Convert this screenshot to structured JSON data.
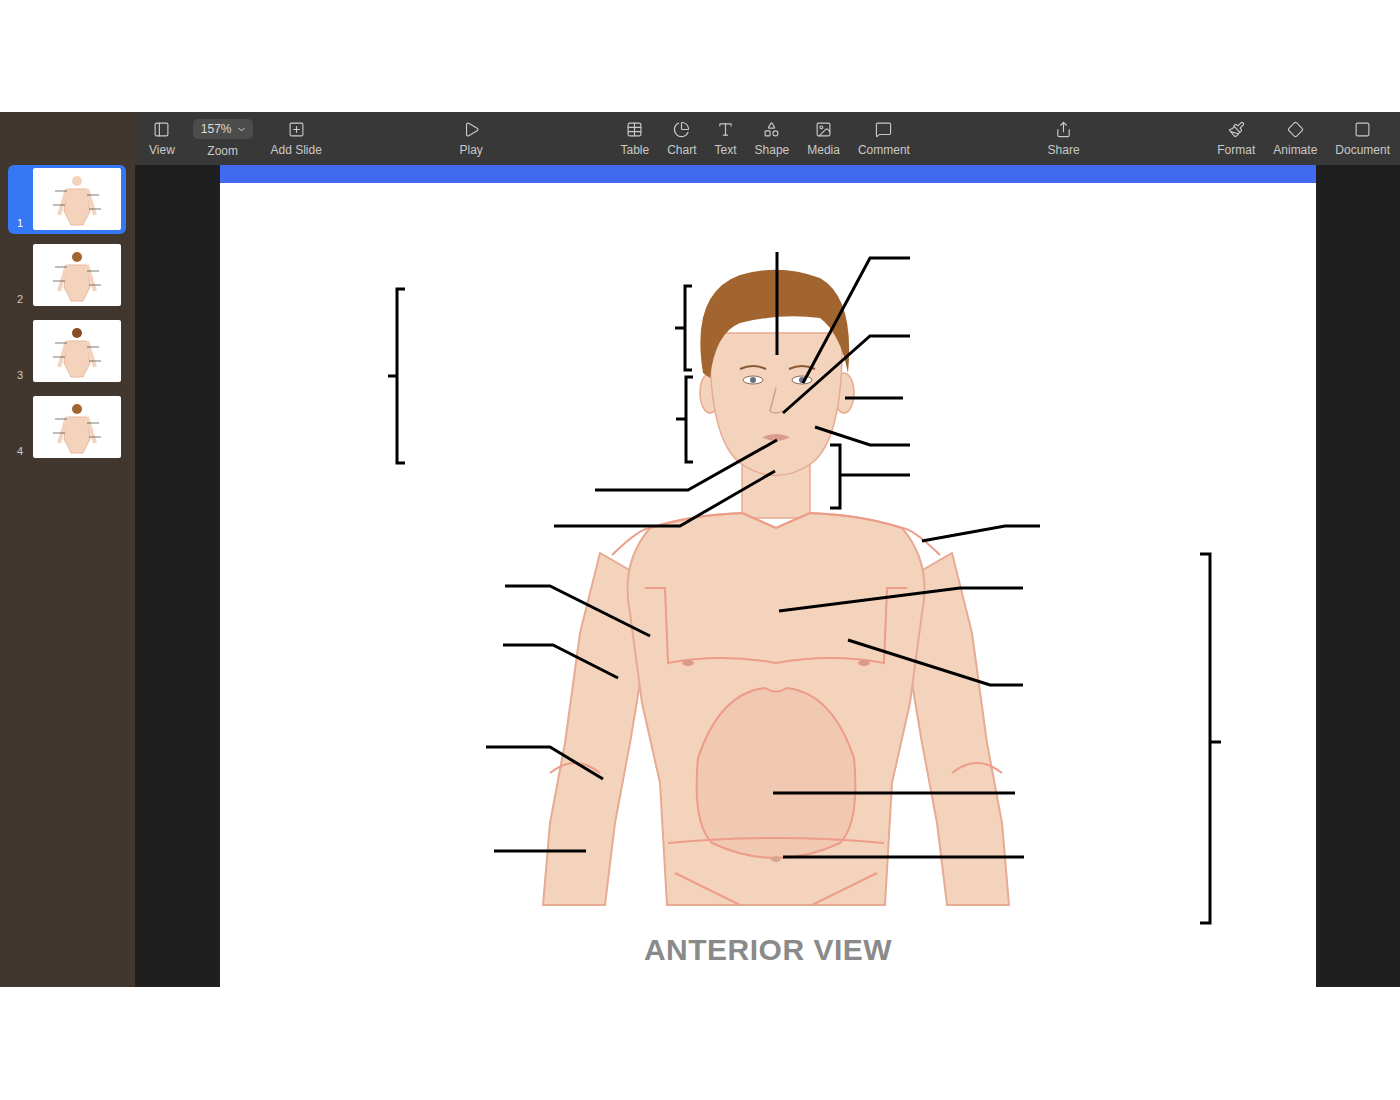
{
  "toolbar": {
    "groups": [
      [
        {
          "label": "View",
          "kind": "button"
        },
        {
          "label": "Zoom",
          "kind": "zoom",
          "value": "157%"
        },
        {
          "label": "Add Slide",
          "kind": "button"
        }
      ],
      [
        {
          "label": "Play",
          "kind": "button"
        }
      ],
      [
        {
          "label": "Table",
          "kind": "button"
        },
        {
          "label": "Chart",
          "kind": "button"
        },
        {
          "label": "Text",
          "kind": "button"
        },
        {
          "label": "Shape",
          "kind": "button"
        },
        {
          "label": "Media",
          "kind": "button"
        },
        {
          "label": "Comment",
          "kind": "button"
        }
      ],
      [
        {
          "label": "Share",
          "kind": "button"
        }
      ],
      [
        {
          "label": "Format",
          "kind": "button"
        },
        {
          "label": "Animate",
          "kind": "button"
        },
        {
          "label": "Document",
          "kind": "button"
        }
      ]
    ]
  },
  "navigator": {
    "slides": [
      {
        "number": "1",
        "selected": true
      },
      {
        "number": "2",
        "selected": false
      },
      {
        "number": "3",
        "selected": false
      },
      {
        "number": "4",
        "selected": false
      }
    ]
  },
  "slide": {
    "title": "ANTERIOR VIEW"
  }
}
